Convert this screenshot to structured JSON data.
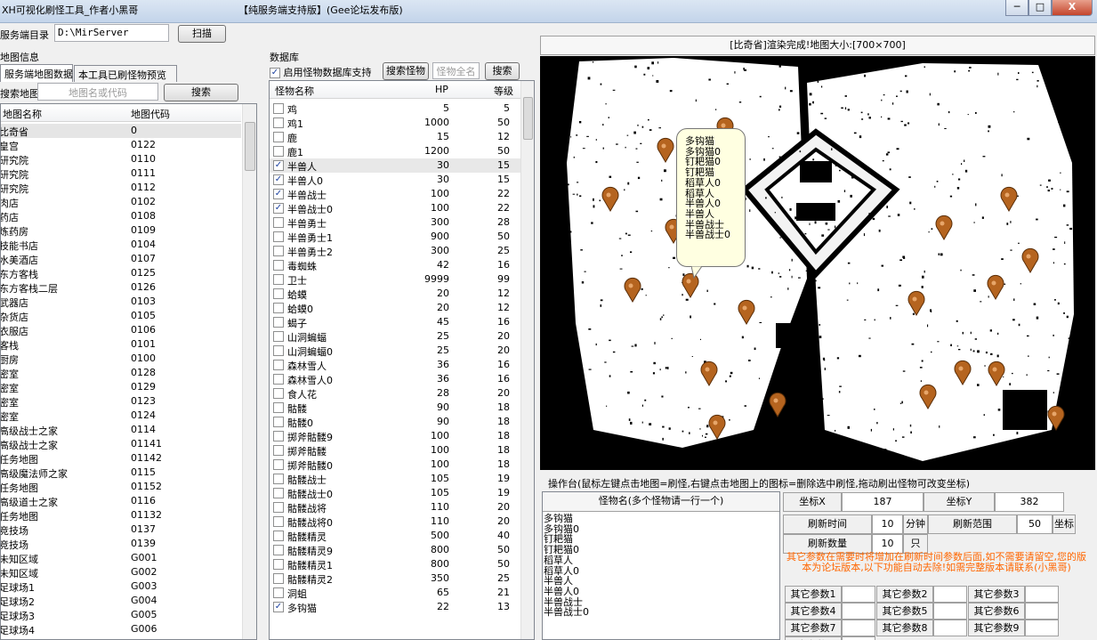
{
  "window": {
    "title_left": "XH可视化刷怪工具_作者小黑哥",
    "title_mid": "【纯服务端支持版】(Gee论坛发布版)",
    "min_label": "─",
    "max_label": "□",
    "close_label": "X"
  },
  "server": {
    "label": "服务端目录",
    "path": "D:\\MirServer",
    "scan_label": "扫描"
  },
  "map_info": {
    "group_label": "地图信息",
    "tabs": [
      "服务端地图数据",
      "本工具已刷怪物预览"
    ],
    "search_label": "搜索地图",
    "search_placeholder": "地图名或代码",
    "search_button": "搜索",
    "col_name": "地图名称",
    "col_code": "地图代码",
    "rows": [
      {
        "name": "比奇省",
        "code": "0"
      },
      {
        "name": "皇宫",
        "code": "0122"
      },
      {
        "name": "研究院",
        "code": "0110"
      },
      {
        "name": "研究院",
        "code": "0111"
      },
      {
        "name": "研究院",
        "code": "0112"
      },
      {
        "name": "肉店",
        "code": "0102"
      },
      {
        "name": "药店",
        "code": "0108"
      },
      {
        "name": "炼药房",
        "code": "0109"
      },
      {
        "name": "技能书店",
        "code": "0104"
      },
      {
        "name": "水美酒店",
        "code": "0107"
      },
      {
        "name": "东方客栈",
        "code": "0125"
      },
      {
        "name": "东方客栈二层",
        "code": "0126"
      },
      {
        "name": "武器店",
        "code": "0103"
      },
      {
        "name": "杂货店",
        "code": "0105"
      },
      {
        "name": "衣服店",
        "code": "0106"
      },
      {
        "name": "客栈",
        "code": "0101"
      },
      {
        "name": "厨房",
        "code": "0100"
      },
      {
        "name": "密室",
        "code": "0128"
      },
      {
        "name": "密室",
        "code": "0129"
      },
      {
        "name": "密室",
        "code": "0123"
      },
      {
        "name": "密室",
        "code": "0124"
      },
      {
        "name": "高级战士之家",
        "code": "0114"
      },
      {
        "name": "高级战士之家",
        "code": "01141"
      },
      {
        "name": "任务地图",
        "code": "01142"
      },
      {
        "name": "高级魔法师之家",
        "code": "0115"
      },
      {
        "name": "任务地图",
        "code": "01152"
      },
      {
        "name": "高级道士之家",
        "code": "0116"
      },
      {
        "name": "任务地图",
        "code": "01132"
      },
      {
        "name": "竞技场",
        "code": "0137"
      },
      {
        "name": "竞技场",
        "code": "0139"
      },
      {
        "name": "未知区域",
        "code": "G001"
      },
      {
        "name": "未知区域",
        "code": "G002"
      },
      {
        "name": "足球场1",
        "code": "G003"
      },
      {
        "name": "足球场2",
        "code": "G004"
      },
      {
        "name": "足球场3",
        "code": "G005"
      },
      {
        "name": "足球场4",
        "code": "G006"
      }
    ]
  },
  "monster_db": {
    "group_label": "数据库",
    "enable_label": "启用怪物数据库支持",
    "search_monster_label": "搜索怪物",
    "fullname_label": "怪物全名",
    "search_button": "搜索",
    "col_name": "怪物名称",
    "col_hp": "HP",
    "col_level": "等级",
    "rows": [
      {
        "checked": false,
        "name": "鸡",
        "hp": "5",
        "level": "5"
      },
      {
        "checked": false,
        "name": "鸡1",
        "hp": "1000",
        "level": "50"
      },
      {
        "checked": false,
        "name": "鹿",
        "hp": "15",
        "level": "12"
      },
      {
        "checked": false,
        "name": "鹿1",
        "hp": "1200",
        "level": "50"
      },
      {
        "checked": true,
        "name": "半兽人",
        "hp": "30",
        "level": "15"
      },
      {
        "checked": true,
        "name": "半兽人0",
        "hp": "30",
        "level": "15"
      },
      {
        "checked": true,
        "name": "半兽战士",
        "hp": "100",
        "level": "22"
      },
      {
        "checked": true,
        "name": "半兽战士0",
        "hp": "100",
        "level": "22"
      },
      {
        "checked": false,
        "name": "半兽勇士",
        "hp": "300",
        "level": "28"
      },
      {
        "checked": false,
        "name": "半兽勇士1",
        "hp": "900",
        "level": "50"
      },
      {
        "checked": false,
        "name": "半兽勇士2",
        "hp": "300",
        "level": "25"
      },
      {
        "checked": false,
        "name": "毒蜘蛛",
        "hp": "42",
        "level": "16"
      },
      {
        "checked": false,
        "name": "卫士",
        "hp": "9999",
        "level": "99"
      },
      {
        "checked": false,
        "name": "蛤蟆",
        "hp": "20",
        "level": "12"
      },
      {
        "checked": false,
        "name": "蛤蟆0",
        "hp": "20",
        "level": "12"
      },
      {
        "checked": false,
        "name": "蝎子",
        "hp": "45",
        "level": "16"
      },
      {
        "checked": false,
        "name": "山洞蝙蝠",
        "hp": "25",
        "level": "20"
      },
      {
        "checked": false,
        "name": "山洞蝙蝠0",
        "hp": "25",
        "level": "20"
      },
      {
        "checked": false,
        "name": "森林雪人",
        "hp": "36",
        "level": "16"
      },
      {
        "checked": false,
        "name": "森林雪人0",
        "hp": "36",
        "level": "16"
      },
      {
        "checked": false,
        "name": "食人花",
        "hp": "28",
        "level": "20"
      },
      {
        "checked": false,
        "name": "骷髅",
        "hp": "90",
        "level": "18"
      },
      {
        "checked": false,
        "name": "骷髅0",
        "hp": "90",
        "level": "18"
      },
      {
        "checked": false,
        "name": "掷斧骷髅9",
        "hp": "100",
        "level": "18"
      },
      {
        "checked": false,
        "name": "掷斧骷髅",
        "hp": "100",
        "level": "18"
      },
      {
        "checked": false,
        "name": "掷斧骷髅0",
        "hp": "100",
        "level": "18"
      },
      {
        "checked": false,
        "name": "骷髅战士",
        "hp": "105",
        "level": "19"
      },
      {
        "checked": false,
        "name": "骷髅战士0",
        "hp": "105",
        "level": "19"
      },
      {
        "checked": false,
        "name": "骷髅战将",
        "hp": "110",
        "level": "20"
      },
      {
        "checked": false,
        "name": "骷髅战将0",
        "hp": "110",
        "level": "20"
      },
      {
        "checked": false,
        "name": "骷髅精灵",
        "hp": "500",
        "level": "40"
      },
      {
        "checked": false,
        "name": "骷髅精灵9",
        "hp": "800",
        "level": "50"
      },
      {
        "checked": false,
        "name": "骷髅精灵1",
        "hp": "800",
        "level": "50"
      },
      {
        "checked": false,
        "name": "骷髅精灵2",
        "hp": "350",
        "level": "25"
      },
      {
        "checked": false,
        "name": "洞蛆",
        "hp": "65",
        "level": "21"
      },
      {
        "checked": true,
        "name": "多钩猫",
        "hp": "22",
        "level": "13"
      }
    ]
  },
  "map_view": {
    "status": "[比奇省]渲染完成!地图大小:[700×700]",
    "tooltip_lines": [
      "多钩猫",
      "多钩猫0",
      "钉耙猫0",
      "钉耙猫",
      "稻草人0",
      "稻草人",
      "半兽人0",
      "半兽人",
      "半兽战士",
      "半兽战士0"
    ],
    "colors": {
      "bg": "#000000",
      "ground": "#ffffff",
      "marker": "#b5641f",
      "tooltip": "#ffffe1"
    }
  },
  "console": {
    "title": "操作台(鼠标左键点击地图=刷怪,右键点击地图上的图标=删除选中刷怪,拖动刷出怪物可改变坐标)",
    "monster_header": "怪物名(多个怪物请一行一个)",
    "monster_lines": [
      "多钩猫",
      "多钩猫0",
      "钉耙猫",
      "钉耙猫0",
      "稻草人",
      "稻草人0",
      "半兽人",
      "半兽人0",
      "半兽战士",
      "半兽战士0"
    ],
    "coord_x_label": "坐标X",
    "coord_x": "187",
    "coord_y_label": "坐标Y",
    "coord_y": "382",
    "refresh_time_label": "刷新时间",
    "refresh_time": "10",
    "refresh_time_unit": "分钟",
    "range_label": "刷新范围",
    "range": "50",
    "range_unit": "坐标",
    "count_label": "刷新数量",
    "count": "10",
    "count_unit": "只",
    "notice": "其它参数在需要时将增加在刷新时间参数后面,如不需要请留空,您的版本为论坛版本,以下功能自动去除!如需完整版本请联系(小黑哥)",
    "params": [
      "其它参数1",
      "其它参数2",
      "其它参数3",
      "其它参数4",
      "其它参数5",
      "其它参数6",
      "其它参数7",
      "其它参数8",
      "其它参数9",
      "其它参数10"
    ]
  }
}
